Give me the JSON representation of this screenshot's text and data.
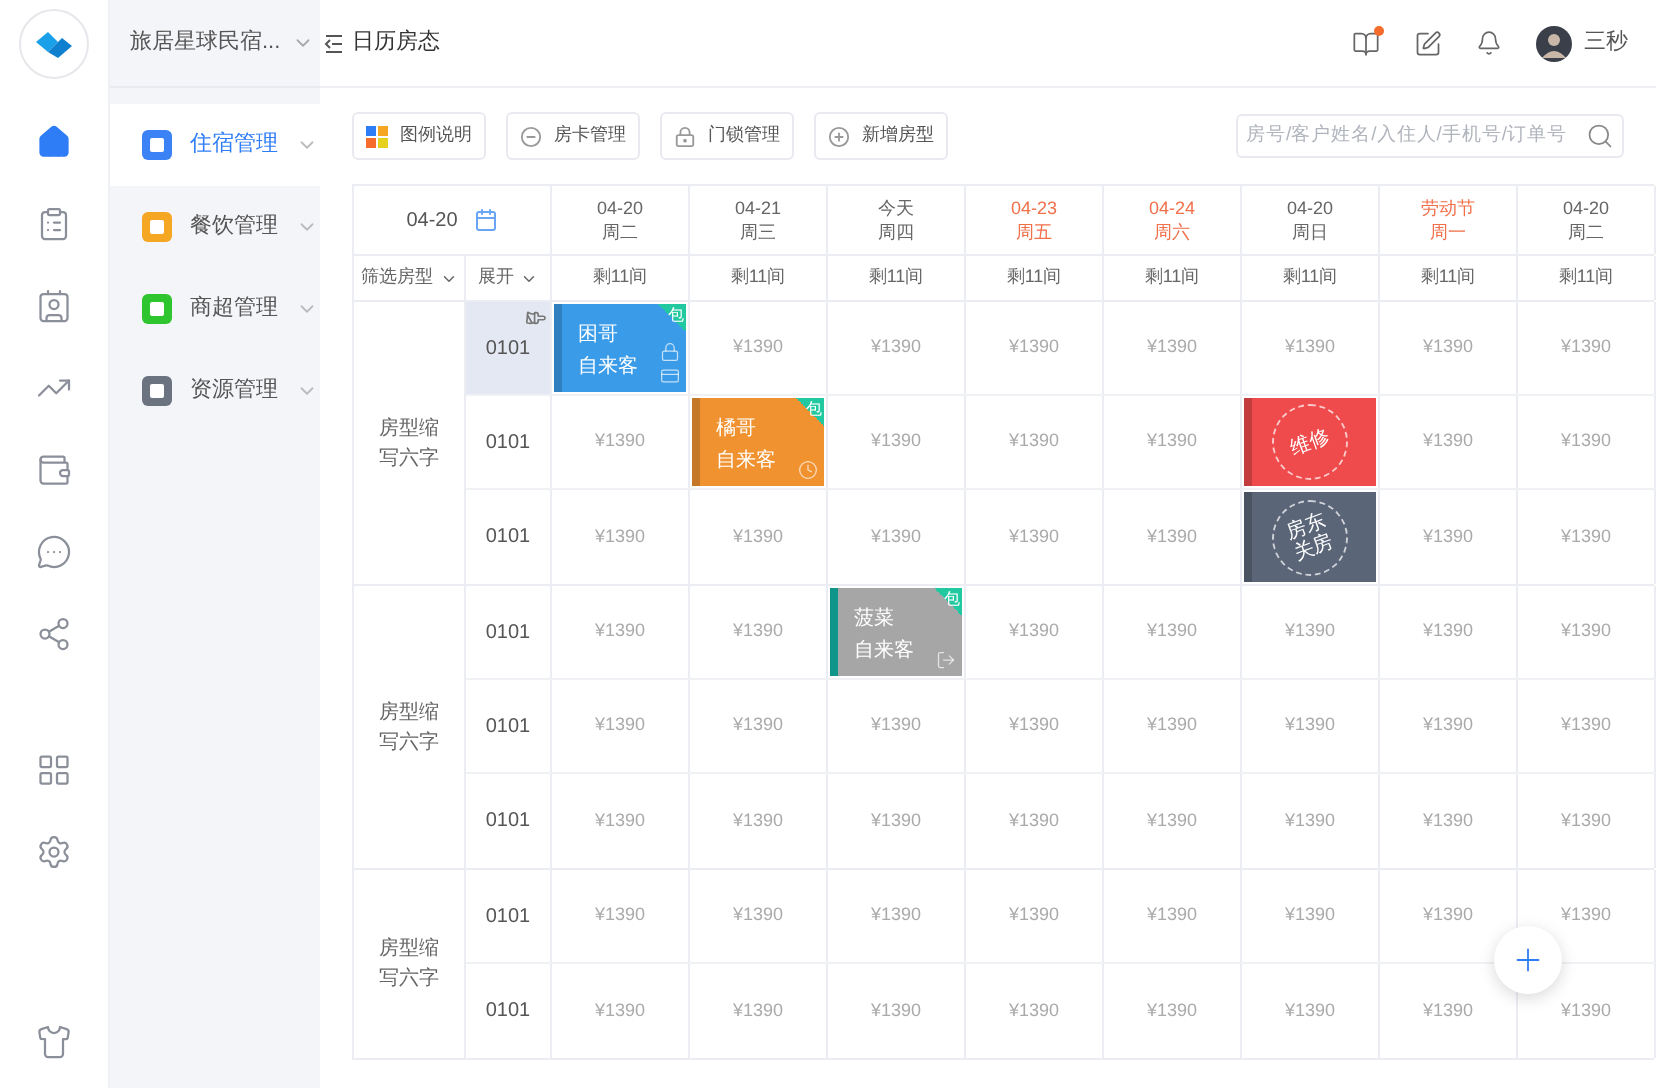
{
  "rail": {
    "main": [
      {
        "selected": true
      },
      {
        "selected": false
      },
      {
        "selected": false
      },
      {
        "selected": false
      },
      {
        "selected": false
      },
      {
        "selected": false
      },
      {
        "selected": false
      }
    ],
    "tools": [
      {
        "selected": false
      },
      {
        "selected": false
      }
    ],
    "footer": [
      {
        "selected": false
      }
    ]
  },
  "sidebar": {
    "store": "旅居星球民宿...",
    "items": [
      {
        "label": "住宿管理",
        "selected": true,
        "color": "#3b82f6"
      },
      {
        "label": "餐饮管理",
        "selected": false,
        "color": "#f5a623"
      },
      {
        "label": "商超管理",
        "selected": false,
        "color": "#2ec52e"
      },
      {
        "label": "资源管理",
        "selected": false,
        "color": "#6b7280"
      }
    ]
  },
  "header": {
    "title": "日历房态",
    "user": "三秒",
    "notification_dot": true
  },
  "toolbar": {
    "buttons": [
      "图例说明",
      "房卡管理",
      "门锁管理",
      "新增房型"
    ],
    "search": {
      "placeholder": "房号/客户姓名/入住人/手机号/订单号"
    }
  },
  "table": {
    "date": "04-20",
    "filter": "筛选房型",
    "expand": "展开",
    "columns": [
      {
        "date": "04-20",
        "weekday": "周二",
        "holiday": false,
        "remaining": "剩11间"
      },
      {
        "date": "04-21",
        "weekday": "周三",
        "holiday": false,
        "remaining": "剩11间"
      },
      {
        "date": "今天",
        "weekday": "周四",
        "holiday": false,
        "remaining": "剩11间"
      },
      {
        "date": "04-23",
        "weekday": "周五",
        "holiday": true,
        "remaining": "剩11间"
      },
      {
        "date": "04-24",
        "weekday": "周六",
        "holiday": true,
        "remaining": "剩11间"
      },
      {
        "date": "04-20",
        "weekday": "周日",
        "holiday": false,
        "remaining": "剩11间"
      },
      {
        "date": "劳动节",
        "weekday": "周一",
        "holiday": true,
        "remaining": "剩11间"
      },
      {
        "date": "04-20",
        "weekday": "周二",
        "holiday": false,
        "remaining": "剩11间"
      }
    ],
    "groups": [
      {
        "label": "房型缩写六字",
        "rows": [
          {
            "room": "0101",
            "dirty": true,
            "cells": [
              {
                "kind": "checkedin",
                "name": "困哥",
                "source": "自来客",
                "badge": "包",
                "color": "#3a9be8"
              },
              {
                "kind": "price",
                "text": "¥1390"
              },
              {
                "kind": "price",
                "text": "¥1390"
              },
              {
                "kind": "price",
                "text": "¥1390"
              },
              {
                "kind": "price",
                "text": "¥1390"
              },
              {
                "kind": "price",
                "text": "¥1390"
              },
              {
                "kind": "price",
                "text": "¥1390"
              },
              {
                "kind": "price",
                "text": "¥1390"
              }
            ]
          },
          {
            "room": "0101",
            "dirty": false,
            "cells": [
              {
                "kind": "price",
                "text": "¥1390"
              },
              {
                "kind": "reserved",
                "name": "橘哥",
                "source": "自来客",
                "badge": "包",
                "color": "#f0922f"
              },
              {
                "kind": "price",
                "text": "¥1390"
              },
              {
                "kind": "price",
                "text": "¥1390"
              },
              {
                "kind": "price",
                "text": "¥1390"
              },
              {
                "kind": "stamp",
                "text": "维修",
                "color": "#ef4b4c"
              },
              {
                "kind": "price",
                "text": "¥1390"
              },
              {
                "kind": "price",
                "text": "¥1390"
              }
            ]
          },
          {
            "room": "0101",
            "dirty": false,
            "cells": [
              {
                "kind": "price",
                "text": "¥1390"
              },
              {
                "kind": "price",
                "text": "¥1390"
              },
              {
                "kind": "price",
                "text": "¥1390"
              },
              {
                "kind": "price",
                "text": "¥1390"
              },
              {
                "kind": "price",
                "text": "¥1390"
              },
              {
                "kind": "stamp",
                "text": "房东关房",
                "color": "#5a6578"
              },
              {
                "kind": "price",
                "text": "¥1390"
              },
              {
                "kind": "price",
                "text": "¥1390"
              }
            ]
          }
        ]
      },
      {
        "label": "房型缩写六字",
        "rows": [
          {
            "room": "0101",
            "dirty": false,
            "cells": [
              {
                "kind": "price",
                "text": "¥1390"
              },
              {
                "kind": "price",
                "text": "¥1390"
              },
              {
                "kind": "checkedout",
                "name": "菠菜",
                "source": "自来客",
                "badge": "包",
                "color": "#a6a6a6"
              },
              {
                "kind": "price",
                "text": "¥1390"
              },
              {
                "kind": "price",
                "text": "¥1390"
              },
              {
                "kind": "price",
                "text": "¥1390"
              },
              {
                "kind": "price",
                "text": "¥1390"
              },
              {
                "kind": "price",
                "text": "¥1390"
              }
            ]
          },
          {
            "room": "0101",
            "dirty": false,
            "cells": [
              {
                "kind": "price",
                "text": "¥1390"
              },
              {
                "kind": "price",
                "text": "¥1390"
              },
              {
                "kind": "price",
                "text": "¥1390"
              },
              {
                "kind": "price",
                "text": "¥1390"
              },
              {
                "kind": "price",
                "text": "¥1390"
              },
              {
                "kind": "price",
                "text": "¥1390"
              },
              {
                "kind": "price",
                "text": "¥1390"
              },
              {
                "kind": "price",
                "text": "¥1390"
              }
            ]
          },
          {
            "room": "0101",
            "dirty": false,
            "cells": [
              {
                "kind": "price",
                "text": "¥1390"
              },
              {
                "kind": "price",
                "text": "¥1390"
              },
              {
                "kind": "price",
                "text": "¥1390"
              },
              {
                "kind": "price",
                "text": "¥1390"
              },
              {
                "kind": "price",
                "text": "¥1390"
              },
              {
                "kind": "price",
                "text": "¥1390"
              },
              {
                "kind": "price",
                "text": "¥1390"
              },
              {
                "kind": "price",
                "text": "¥1390"
              }
            ]
          }
        ]
      },
      {
        "label": "房型缩写六字",
        "rows": [
          {
            "room": "0101",
            "dirty": false,
            "cells": [
              {
                "kind": "price",
                "text": "¥1390"
              },
              {
                "kind": "price",
                "text": "¥1390"
              },
              {
                "kind": "price",
                "text": "¥1390"
              },
              {
                "kind": "price",
                "text": "¥1390"
              },
              {
                "kind": "price",
                "text": "¥1390"
              },
              {
                "kind": "price",
                "text": "¥1390"
              },
              {
                "kind": "price",
                "text": "¥1390"
              },
              {
                "kind": "price",
                "text": "¥1390"
              }
            ]
          },
          {
            "room": "0101",
            "dirty": false,
            "cells": [
              {
                "kind": "price",
                "text": "¥1390"
              },
              {
                "kind": "price",
                "text": "¥1390"
              },
              {
                "kind": "price",
                "text": "¥1390"
              },
              {
                "kind": "price",
                "text": "¥1390"
              },
              {
                "kind": "price",
                "text": "¥1390"
              },
              {
                "kind": "price",
                "text": "¥1390"
              },
              {
                "kind": "price",
                "text": "¥1390"
              },
              {
                "kind": "price",
                "text": "¥1390"
              }
            ]
          }
        ]
      }
    ]
  }
}
